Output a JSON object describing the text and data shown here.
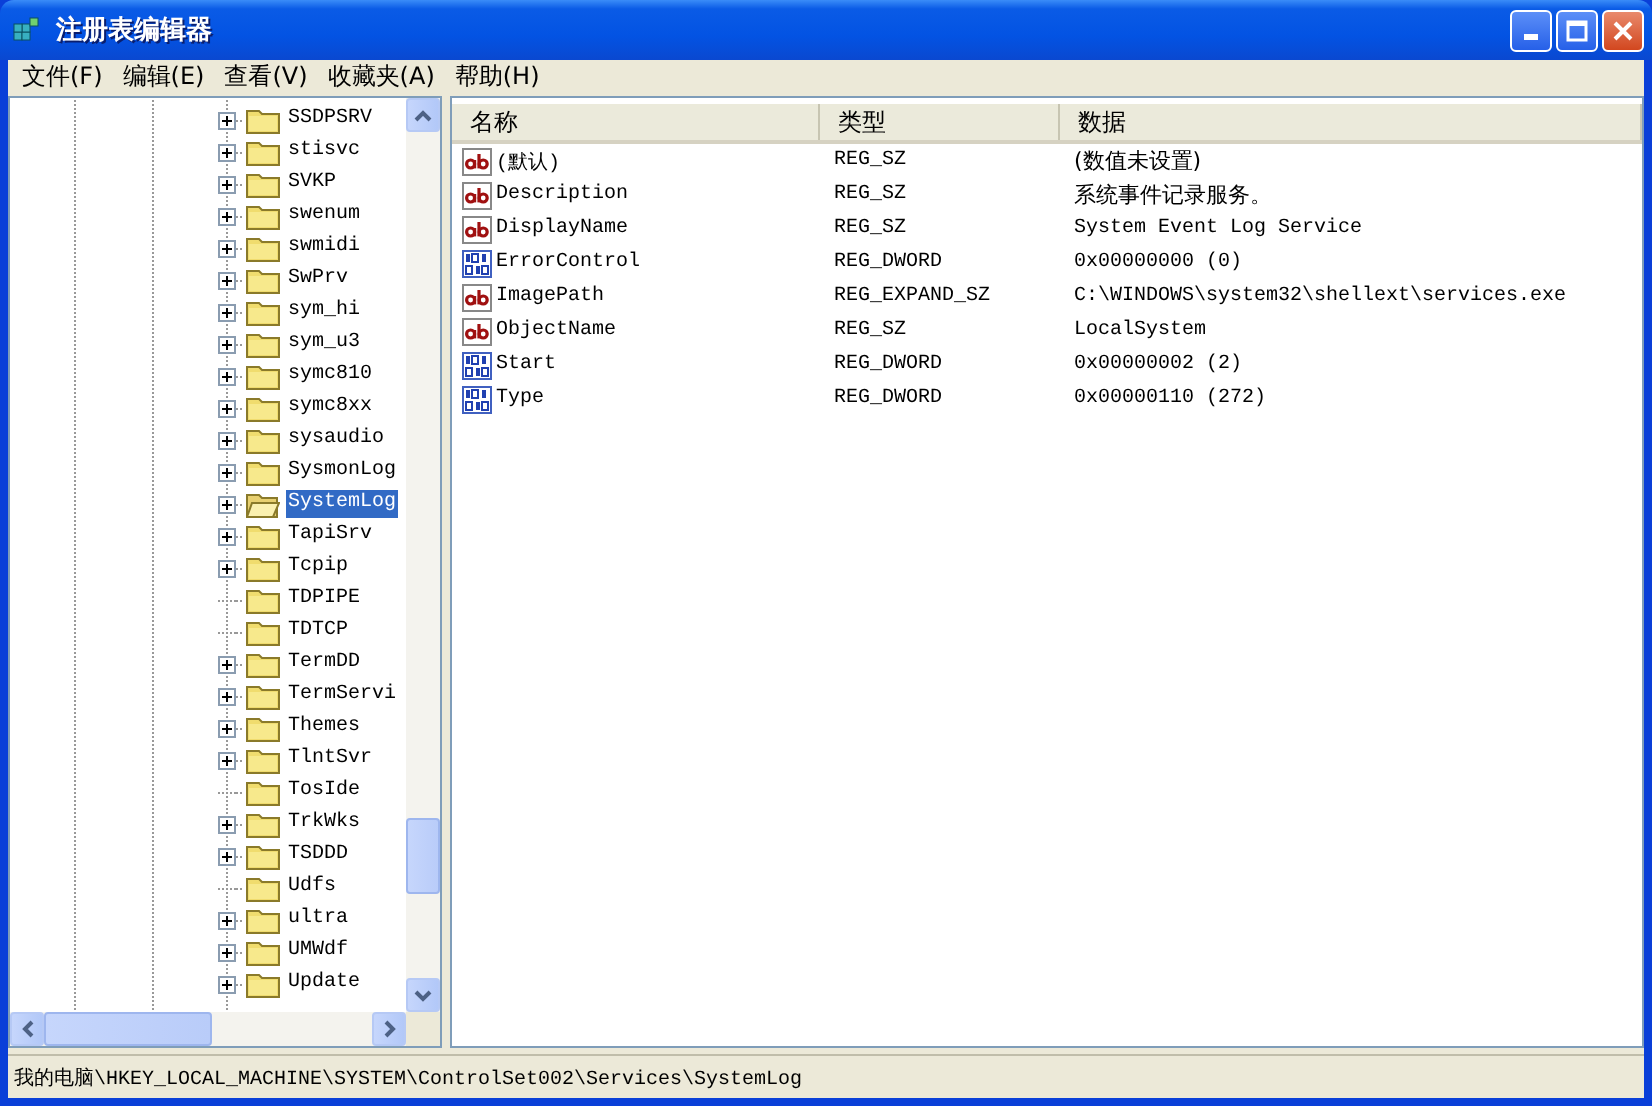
{
  "window": {
    "title": "注册表编辑器"
  },
  "menu": [
    {
      "label": "文件(F)"
    },
    {
      "label": "编辑(E)"
    },
    {
      "label": "查看(V)"
    },
    {
      "label": "收藏夹(A)"
    },
    {
      "label": "帮助(H)"
    }
  ],
  "tree": {
    "items": [
      {
        "label": "SSDPSRV",
        "expandable": true,
        "selected": false
      },
      {
        "label": "stisvc",
        "expandable": true,
        "selected": false
      },
      {
        "label": "SVKP",
        "expandable": true,
        "selected": false
      },
      {
        "label": "swenum",
        "expandable": true,
        "selected": false
      },
      {
        "label": "swmidi",
        "expandable": true,
        "selected": false
      },
      {
        "label": "SwPrv",
        "expandable": true,
        "selected": false
      },
      {
        "label": "sym_hi",
        "expandable": true,
        "selected": false
      },
      {
        "label": "sym_u3",
        "expandable": true,
        "selected": false
      },
      {
        "label": "symc810",
        "expandable": true,
        "selected": false
      },
      {
        "label": "symc8xx",
        "expandable": true,
        "selected": false
      },
      {
        "label": "sysaudio",
        "expandable": true,
        "selected": false
      },
      {
        "label": "SysmonLog",
        "expandable": true,
        "selected": false
      },
      {
        "label": "SystemLog",
        "expandable": true,
        "selected": true
      },
      {
        "label": "TapiSrv",
        "expandable": true,
        "selected": false
      },
      {
        "label": "Tcpip",
        "expandable": true,
        "selected": false
      },
      {
        "label": "TDPIPE",
        "expandable": false,
        "selected": false
      },
      {
        "label": "TDTCP",
        "expandable": false,
        "selected": false
      },
      {
        "label": "TermDD",
        "expandable": true,
        "selected": false
      },
      {
        "label": "TermServi",
        "expandable": true,
        "selected": false
      },
      {
        "label": "Themes",
        "expandable": true,
        "selected": false
      },
      {
        "label": "TlntSvr",
        "expandable": true,
        "selected": false
      },
      {
        "label": "TosIde",
        "expandable": false,
        "selected": false
      },
      {
        "label": "TrkWks",
        "expandable": true,
        "selected": false
      },
      {
        "label": "TSDDD",
        "expandable": true,
        "selected": false
      },
      {
        "label": "Udfs",
        "expandable": false,
        "selected": false
      },
      {
        "label": "ultra",
        "expandable": true,
        "selected": false
      },
      {
        "label": "UMWdf",
        "expandable": true,
        "selected": false
      },
      {
        "label": "Update",
        "expandable": true,
        "selected": false
      }
    ]
  },
  "list": {
    "columns": [
      "名称",
      "类型",
      "数据"
    ],
    "rows": [
      {
        "kind": "string",
        "name": "(默认)",
        "type": "REG_SZ",
        "data": "(数值未设置)"
      },
      {
        "kind": "string",
        "name": "Description",
        "type": "REG_SZ",
        "data": "系统事件记录服务。"
      },
      {
        "kind": "string",
        "name": "DisplayName",
        "type": "REG_SZ",
        "data": "System Event Log Service"
      },
      {
        "kind": "binary",
        "name": "ErrorControl",
        "type": "REG_DWORD",
        "data": "0x00000000 (0)"
      },
      {
        "kind": "string",
        "name": "ImagePath",
        "type": "REG_EXPAND_SZ",
        "data": "C:\\WINDOWS\\system32\\shellext\\services.exe"
      },
      {
        "kind": "string",
        "name": "ObjectName",
        "type": "REG_SZ",
        "data": "LocalSystem"
      },
      {
        "kind": "binary",
        "name": "Start",
        "type": "REG_DWORD",
        "data": "0x00000002 (2)"
      },
      {
        "kind": "binary",
        "name": "Type",
        "type": "REG_DWORD",
        "data": "0x00000110 (272)"
      }
    ]
  },
  "status_bar": {
    "text": "我的电脑\\HKEY_LOCAL_MACHINE\\SYSTEM\\ControlSet002\\Services\\SystemLog"
  }
}
